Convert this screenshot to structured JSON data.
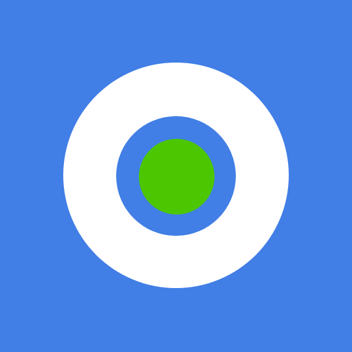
{
  "icon": {
    "name": "target-record-icon",
    "colors": {
      "background": "#417EE6",
      "outer_ring": "#FFFFFF",
      "inner_ring": "#417EE6",
      "center_dot": "#4CC600"
    }
  }
}
